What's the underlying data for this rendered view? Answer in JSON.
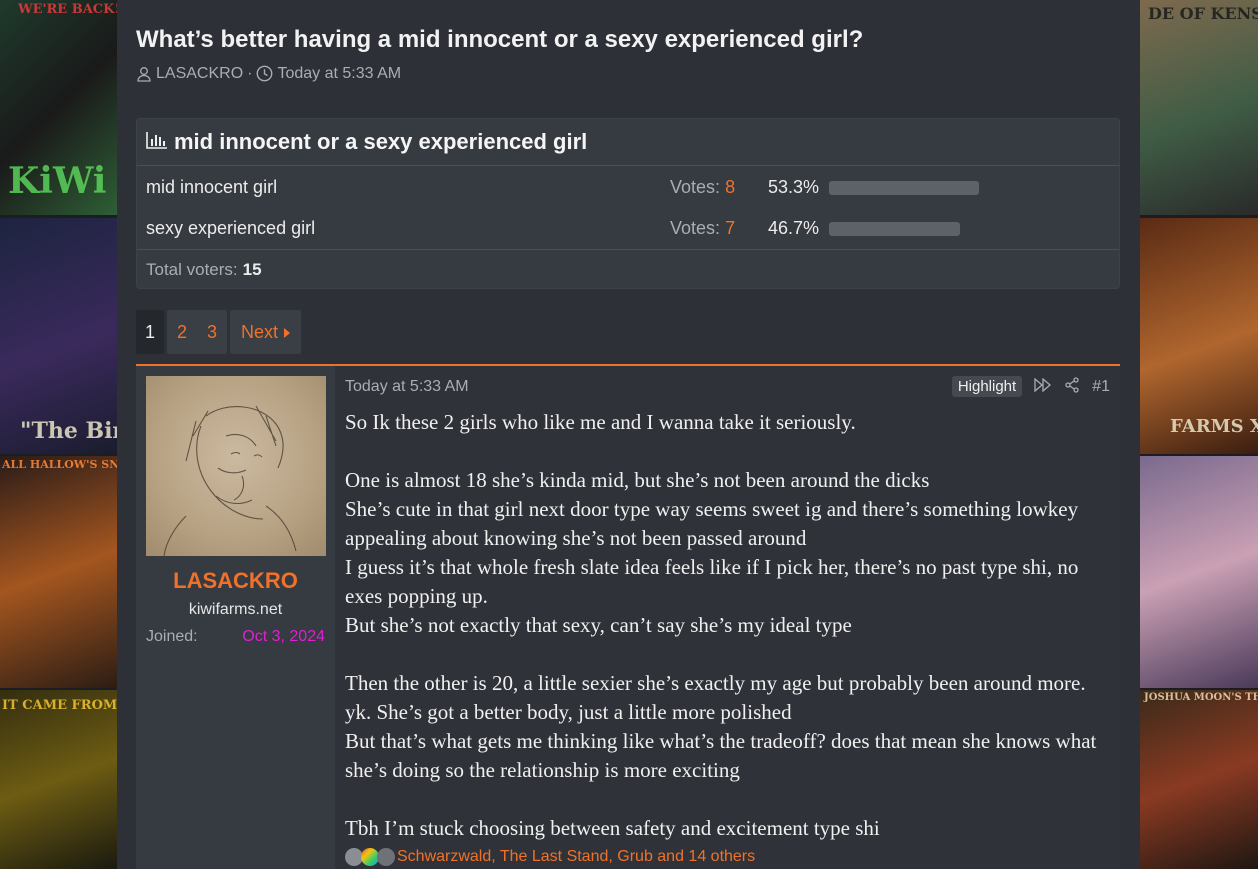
{
  "side_art": {
    "left_captions": [
      "WE'RE BACK!",
      "KiWi",
      "\"The Bird",
      "ALL HALLOW'S SNEED",
      "IT CAME FROM THE CORNFIELD"
    ],
    "right_captions": [
      "DE OF KENSTEIN",
      "FARMS X",
      "JOSHUA MOON'S THE COON"
    ]
  },
  "thread": {
    "title": "What’s better having a mid innocent or a sexy experienced girl?",
    "author": "LASACKRO",
    "separator": "·",
    "time": "Today at 5:33 AM"
  },
  "poll": {
    "title": "mid innocent or a sexy experienced girl",
    "options": [
      {
        "label": "mid innocent girl",
        "votes_label": "Votes:",
        "votes": "8",
        "percent_text": "53.3%",
        "fraction": 0.533
      },
      {
        "label": "sexy experienced girl",
        "votes_label": "Votes:",
        "votes": "7",
        "percent_text": "46.7%",
        "fraction": 0.467
      }
    ],
    "total_label": "Total voters:",
    "total": "15"
  },
  "pagination": {
    "pages": [
      "1",
      "2",
      "3"
    ],
    "current": "1",
    "next_label": "Next"
  },
  "post": {
    "user": {
      "name": "LASACKRO",
      "title": "kiwifarms.net",
      "joined_label": "Joined:",
      "joined_date": "Oct 3, 2024"
    },
    "date": "Today at 5:33 AM",
    "highlight_label": "Highlight",
    "number": "#1",
    "paragraphs": [
      "So Ik these 2 girls who like me and I wanna take it seriously.",
      "One is almost 18 she’s kinda mid, but she’s not been around the dicks\nShe’s cute in that girl next door type way seems sweet ig and there’s something lowkey appealing about knowing she’s not been passed around\nI guess it’s that whole fresh slate idea feels like if I pick her, there’s no past type shi, no exes popping up.\nBut she’s not exactly that sexy, can’t say she’s my ideal type",
      "Then the other is 20, a little sexier she’s exactly my age but probably been around more. yk. She’s got a better body, just a little more polished\nBut that’s what gets me thinking like what’s the tradeoff? does that mean she knows what she’s doing so the relationship is more exciting",
      "Tbh I’m stuck choosing between safety and excitement type shi"
    ],
    "reactions_text": "Schwarzwald, The Last Stand, Grub and 14 others"
  },
  "colors": {
    "accent": "#f0722a",
    "joined_date": "#e020d0",
    "background": "#2d3036"
  }
}
